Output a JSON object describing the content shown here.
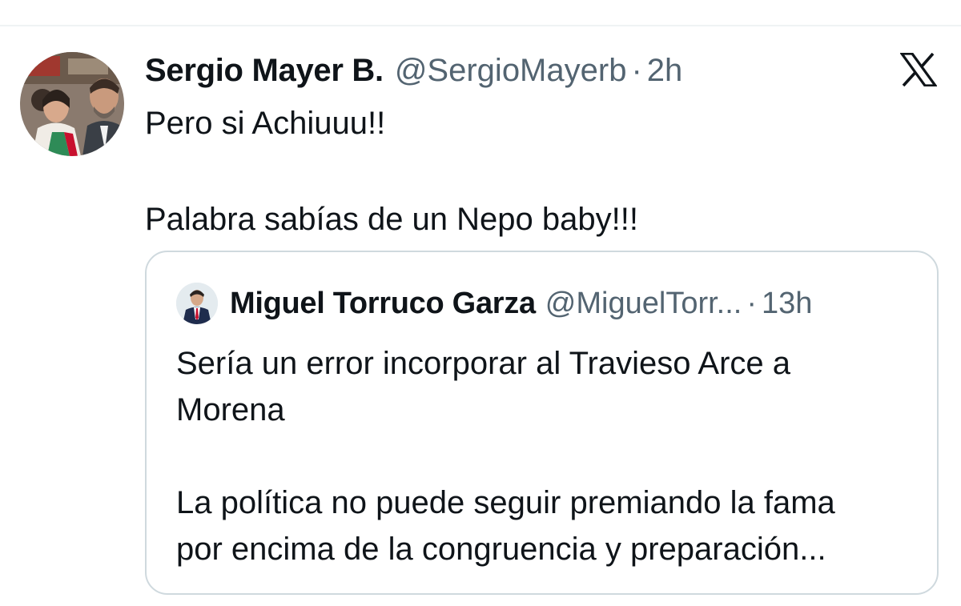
{
  "tweet": {
    "author": {
      "display_name": "Sergio Mayer B.",
      "handle": "@SergioMayerb",
      "avatar_icon": "profile-photo"
    },
    "separator": "·",
    "time": "2h",
    "text_lines": [
      "Pero si Achiuuu!!",
      "",
      "Palabra sabías de un Nepo baby!!!"
    ],
    "platform_icon": "x-logo-icon"
  },
  "quoted_tweet": {
    "author": {
      "display_name": "Miguel Torruco Garza",
      "handle": "@MiguelTorr...",
      "avatar_icon": "profile-photo"
    },
    "separator": "·",
    "time": "13h",
    "text_lines": [
      "Sería un error incorporar al Travieso Arce a",
      "Morena",
      "",
      "La política no puede seguir premiando la fama",
      "por encima de la congruencia y preparación..."
    ]
  },
  "colors": {
    "text_primary": "#0f1419",
    "text_secondary": "#536471",
    "border": "#cfd9de",
    "background": "#ffffff"
  }
}
